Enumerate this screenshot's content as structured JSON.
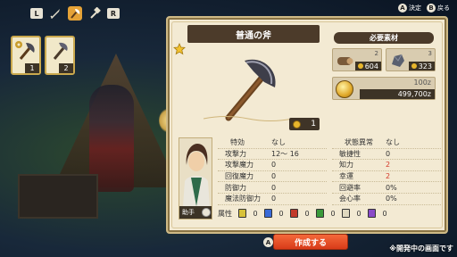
{
  "tabs": {
    "left_key": "L",
    "right_key": "R",
    "items": [
      {
        "icon": "sword-icon",
        "active": false
      },
      {
        "icon": "axe-icon",
        "active": true
      },
      {
        "icon": "hammer-icon",
        "active": false
      }
    ]
  },
  "inventory": [
    {
      "icon": "axe-icon",
      "count": "1"
    },
    {
      "icon": "axe-icon",
      "count": "2"
    }
  ],
  "hints": {
    "confirm_key": "A",
    "confirm_label": "決定",
    "back_key": "B",
    "back_label": "戻る"
  },
  "item": {
    "name": "普通の斧",
    "owned": "1",
    "icon": "axe-icon"
  },
  "materials": {
    "title": "必要素材",
    "items": [
      {
        "icon": "log-icon",
        "need": "2",
        "have": "604"
      },
      {
        "icon": "ore-icon",
        "need": "3",
        "have": "323"
      }
    ],
    "money_cost": "100z",
    "money_have": "499,700z"
  },
  "helper": {
    "label": "助手"
  },
  "stats": {
    "left": [
      {
        "label": "特効",
        "value": "なし",
        "header": true
      },
      {
        "label": "攻撃力",
        "value": "12〜 16"
      },
      {
        "label": "攻撃魔力",
        "value": "0"
      },
      {
        "label": "回復魔力",
        "value": "0"
      },
      {
        "label": "防御力",
        "value": "0"
      },
      {
        "label": "魔法防御力",
        "value": "0"
      }
    ],
    "right": [
      {
        "label": "状態異常",
        "value": "なし",
        "header": true
      },
      {
        "label": "敏捷性",
        "value": "0"
      },
      {
        "label": "知力",
        "value": "2",
        "highlight": true
      },
      {
        "label": "幸運",
        "value": "2",
        "highlight": true
      },
      {
        "label": "回避率",
        "value": "0%"
      },
      {
        "label": "会心率",
        "value": "0%"
      }
    ]
  },
  "attributes": {
    "label": "属性",
    "items": [
      {
        "color": "#d8c23a",
        "value": "0"
      },
      {
        "color": "#3a6bd8",
        "value": "0"
      },
      {
        "color": "#c23a2a",
        "value": "0"
      },
      {
        "color": "#3a9a3a",
        "value": "0"
      },
      {
        "color": "#e0d9c0",
        "value": "0"
      },
      {
        "color": "#8a4ac8",
        "value": "0"
      }
    ]
  },
  "create_button": {
    "key": "A",
    "label": "作成する"
  },
  "disclaimer": "※開発中の画面です",
  "colors": {
    "panel_bg": "#f3ead3",
    "banner": "#4c3b2a",
    "accent_orange": "#e5a237",
    "create_button": "#e0491f",
    "highlight_red": "#d43a2b"
  }
}
